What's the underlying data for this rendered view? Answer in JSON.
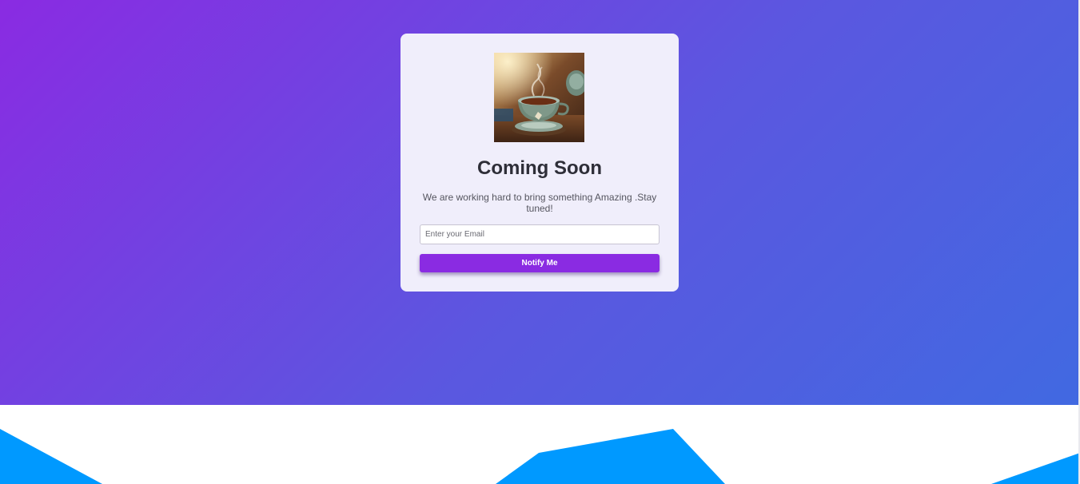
{
  "card": {
    "image_alt": "steaming cup of tea on saucer",
    "title": "Coming Soon",
    "subtitle": "We are working hard to bring something Amazing .Stay tuned!",
    "email_placeholder": "Enter your Email",
    "email_value": "",
    "button_label": "Notify Me"
  },
  "colors": {
    "gradient_start": "#8a2be2",
    "gradient_end": "#4169e1",
    "card_background": "#f0eefb",
    "button": "#8a2be2",
    "wave": "#0099ff"
  },
  "icons": {
    "hero_image": "tea-cup-icon"
  }
}
